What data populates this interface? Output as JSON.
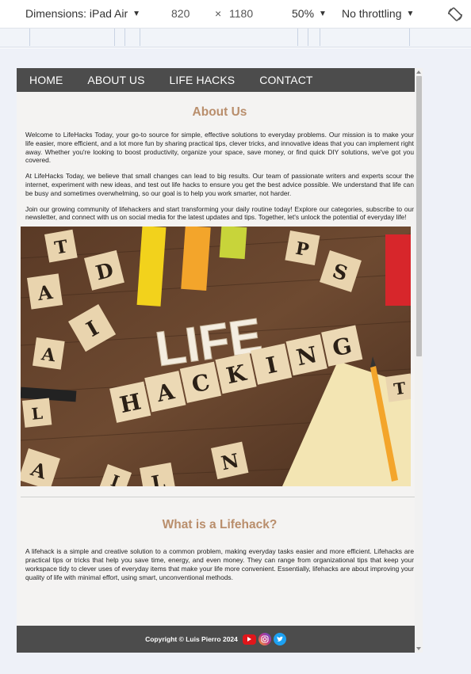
{
  "devtools": {
    "dimensions_label": "Dimensions: iPad Air",
    "width": "820",
    "times": "×",
    "height": "1180",
    "zoom": "50%",
    "throttling": "No throttling"
  },
  "nav": {
    "items": [
      {
        "label": "HOME"
      },
      {
        "label": "ABOUT US"
      },
      {
        "label": "LIFE HACKS"
      },
      {
        "label": "CONTACT"
      }
    ]
  },
  "about": {
    "title": "About Us",
    "paragraphs": [
      "Welcome to LifeHacks Today, your go-to source for simple, effective solutions to everyday problems. Our mission is to make your life easier, more efficient, and a lot more fun by sharing practical tips, clever tricks, and innovative ideas that you can implement right away. Whether you're looking to boost productivity, organize your space, save money, or find quick DIY solutions, we've got you covered.",
      "At LifeHacks Today, we believe that small changes can lead to big results. Our team of passionate writers and experts scour the internet, experiment with new ideas, and test out life hacks to ensure you get the best advice possible. We understand that life can be busy and sometimes overwhelming, so our goal is to help you work smarter, not harder.",
      "Join our growing community of lifehackers and start transforming your daily routine today! Explore our categories, subscribe to our newsletter, and connect with us on social media for the latest updates and tips. Together, let's unlock the potential of everyday life!"
    ]
  },
  "hero": {
    "word_top": "LIFE",
    "word_bottom": "HACKING",
    "scattered_tiles": [
      "T",
      "A",
      "D",
      "A",
      "S",
      "I",
      "L",
      "P",
      "N",
      "T",
      "A",
      "L",
      "I"
    ]
  },
  "lifehack": {
    "title": "What is a Lifehack?",
    "paragraph": "A lifehack is a simple and creative solution to a common problem, making everyday tasks easier and more efficient. Lifehacks are practical tips or tricks that help you save time, energy, and even money. They can range from organizational tips that keep your workspace tidy to clever uses of everyday items that make your life more convenient. Essentially, lifehacks are about improving your quality of life with minimal effort, using smart, unconventional methods."
  },
  "footer": {
    "copyright": "Copyright © Luis Pierro 2024"
  },
  "colors": {
    "nav_bg": "#4c4c4c",
    "heading": "#b98e6c",
    "page_bg": "#f4f3f2",
    "youtube": "#e0161b",
    "instagram": "#c13584",
    "twitter": "#1da1f2"
  }
}
